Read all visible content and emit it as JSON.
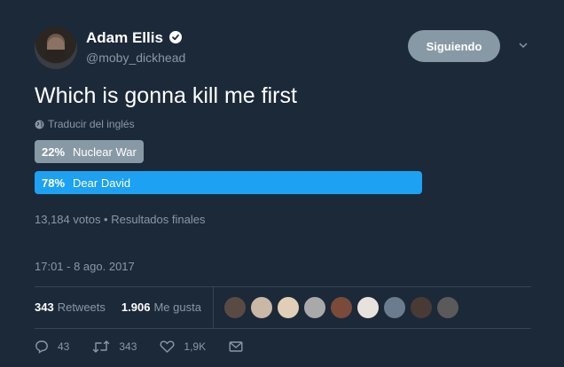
{
  "author": {
    "name": "Adam Ellis",
    "handle": "@moby_dickhead",
    "verified": true
  },
  "follow_button": {
    "label": "Siguiendo"
  },
  "tweet": {
    "text": "Which is gonna kill me first",
    "translate_label": "Traducir del inglés"
  },
  "poll": {
    "options": [
      {
        "percent_label": "22%",
        "label": "Nuclear War",
        "share": 0.22
      },
      {
        "percent_label": "78%",
        "label": "Dear David",
        "share": 0.78
      }
    ],
    "meta": "13,184 votos • Resultados finales"
  },
  "timestamp": "17:01 - 8 ago. 2017",
  "stats": {
    "retweets_count": "343",
    "retweets_label": "Retweets",
    "likes_count": "1.906",
    "likes_label": "Me gusta"
  },
  "liker_avatars": [
    {
      "color": "#5a4a44"
    },
    {
      "color": "#c9b8a6"
    },
    {
      "color": "#e0cfb6"
    },
    {
      "color": "#a9a9a9"
    },
    {
      "color": "#7a4a3a"
    },
    {
      "color": "#e8e2dd"
    },
    {
      "color": "#6b7c8f"
    },
    {
      "color": "#4a3a35"
    },
    {
      "color": "#5a5a5a"
    }
  ],
  "actions": {
    "reply_count": "43",
    "retweet_count": "343",
    "like_count": "1,9K"
  },
  "colors": {
    "background": "#1c2938",
    "accent": "#1da1f2",
    "muted": "#8899a6",
    "divider": "#38444d"
  }
}
